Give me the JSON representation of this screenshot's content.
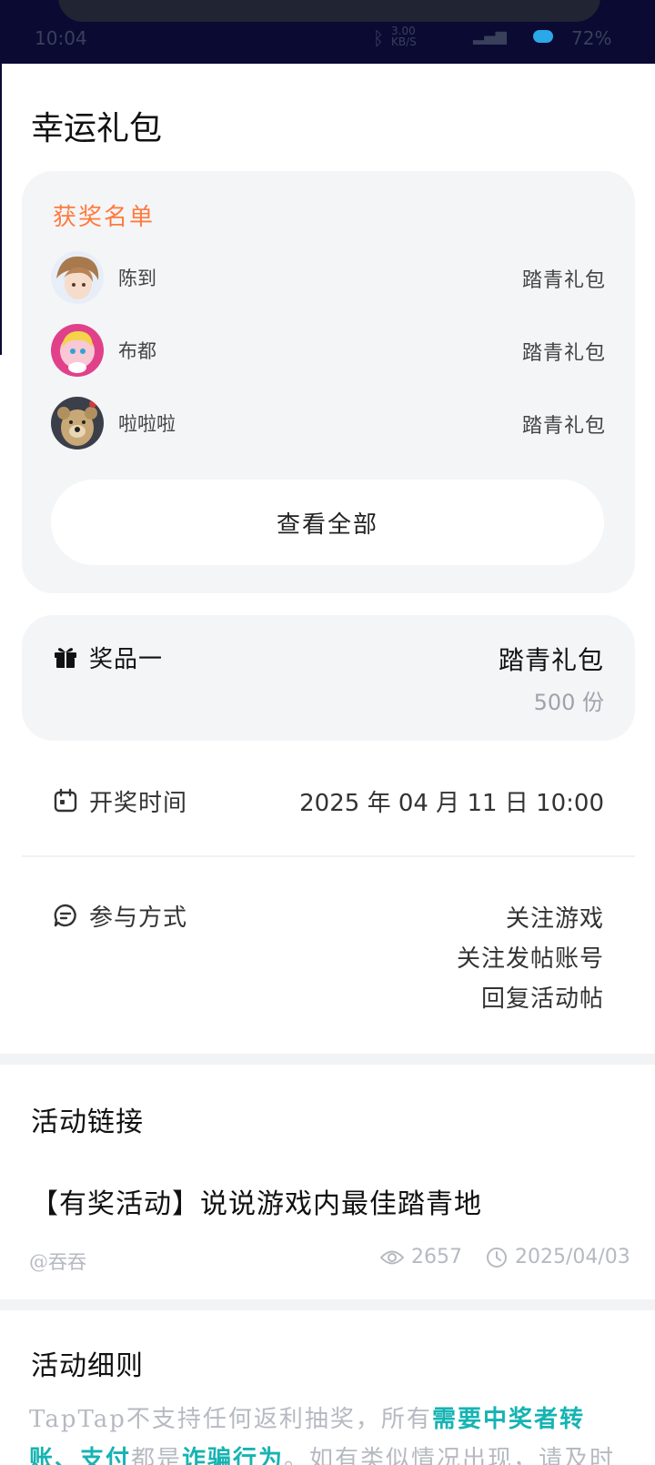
{
  "status_bar": {
    "time": "10:04",
    "network_speed": "3.00\nKB/S",
    "battery": "72%"
  },
  "page": {
    "title": "幸运礼包"
  },
  "winners": {
    "heading": "获奖名单",
    "rows": [
      {
        "name": "陈到",
        "prize": "踏青礼包"
      },
      {
        "name": "布都",
        "prize": "踏青礼包"
      },
      {
        "name": "啦啦啦",
        "prize": "踏青礼包"
      }
    ],
    "view_all_label": "查看全部"
  },
  "prize": {
    "label": "奖品一",
    "name": "踏青礼包",
    "quantity": "500 份"
  },
  "draw_time": {
    "label": "开奖时间",
    "value": "2025 年 04 月 11 日 10:00"
  },
  "participation": {
    "label": "参与方式",
    "methods": [
      "关注游戏",
      "关注发帖账号",
      "回复活动帖"
    ]
  },
  "activity_link": {
    "section_title": "活动链接",
    "post_title": "【有奖活动】说说游戏内最佳踏青地",
    "author": "@吞吞",
    "views": "2657",
    "date": "2025/04/03"
  },
  "rules": {
    "section_title": "活动细则",
    "text_part1": "TapTap不支持任何返利抽奖，所有",
    "highlight1": "需要中奖者转账、支付",
    "text_part2": "都是",
    "highlight2": "诈骗行为",
    "text_part3": "。如有类似情况出现，请及时"
  },
  "colors": {
    "accent_orange": "#ff7a3d",
    "highlight_teal": "#16b3b3",
    "card_bg": "#f4f5f7",
    "muted_text": "#b6bac0"
  }
}
